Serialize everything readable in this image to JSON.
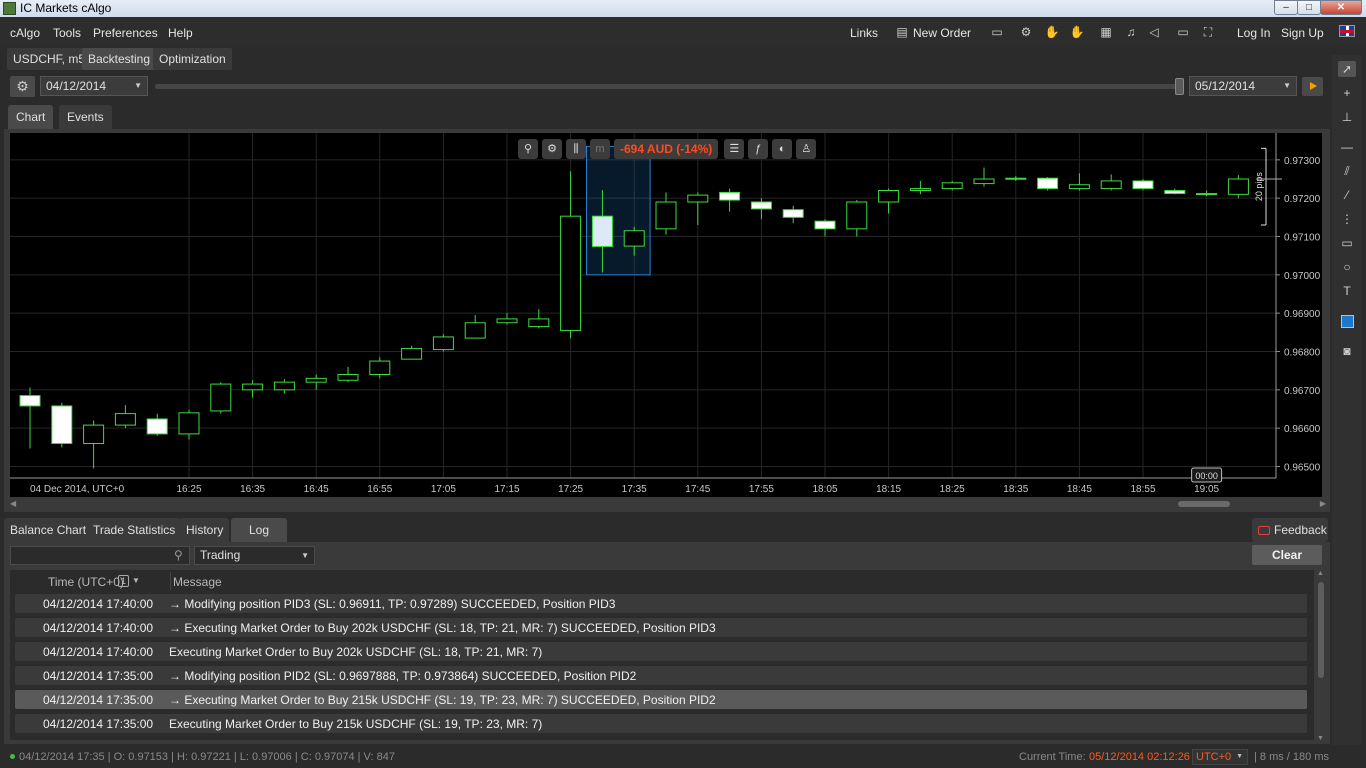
{
  "window": {
    "title": "IC Markets cAlgo",
    "min": "–",
    "max": "□",
    "close": "✕"
  },
  "menu": {
    "items": [
      "cAlgo",
      "Tools",
      "Preferences",
      "Help"
    ]
  },
  "topright": {
    "links": "Links",
    "new_order": "New Order",
    "login": "Log In",
    "signup": "Sign Up"
  },
  "tabs": [
    "USDCHF, m5",
    "Backtesting",
    "Optimization"
  ],
  "backtest": {
    "start_date": "04/12/2014",
    "end_date": "05/12/2014"
  },
  "chart_tabs": [
    "Chart",
    "Events"
  ],
  "chart_toolbar": {
    "pnl": "-694 AUD (-14%)"
  },
  "chart_data": {
    "type": "candlestick",
    "symbol": "USDCHF",
    "timeframe": "m5",
    "date_label": "04 Dec 2014, UTC+0",
    "x_ticks": [
      "16:25",
      "16:35",
      "16:45",
      "16:55",
      "17:05",
      "17:15",
      "17:25",
      "17:35",
      "17:45",
      "17:55",
      "18:05",
      "18:15",
      "18:25",
      "18:35",
      "18:45",
      "18:55",
      "19:05"
    ],
    "y_ticks": [
      "0.97300",
      "0.97200",
      "0.97100",
      "0.97000",
      "0.96900",
      "0.96800",
      "0.96700",
      "0.96600",
      "0.96500"
    ],
    "ylim": [
      0.9647,
      0.9737
    ],
    "crosshair_time": "00:00",
    "pips_label": "20 pips",
    "candles": [
      {
        "o": 0.96685,
        "h": 0.96706,
        "l": 0.96547,
        "c": 0.96658
      },
      {
        "o": 0.96658,
        "h": 0.96666,
        "l": 0.9655,
        "c": 0.9656
      },
      {
        "o": 0.9656,
        "h": 0.9662,
        "l": 0.96495,
        "c": 0.96608
      },
      {
        "o": 0.96608,
        "h": 0.9666,
        "l": 0.966,
        "c": 0.96638
      },
      {
        "o": 0.96624,
        "h": 0.96638,
        "l": 0.9658,
        "c": 0.96585
      },
      {
        "o": 0.96585,
        "h": 0.96648,
        "l": 0.9657,
        "c": 0.9664
      },
      {
        "o": 0.96645,
        "h": 0.9672,
        "l": 0.96638,
        "c": 0.96715
      },
      {
        "o": 0.967,
        "h": 0.96725,
        "l": 0.9668,
        "c": 0.96715
      },
      {
        "o": 0.967,
        "h": 0.96728,
        "l": 0.9669,
        "c": 0.9672
      },
      {
        "o": 0.9672,
        "h": 0.9674,
        "l": 0.967,
        "c": 0.9673
      },
      {
        "o": 0.96725,
        "h": 0.9676,
        "l": 0.9672,
        "c": 0.9674
      },
      {
        "o": 0.9674,
        "h": 0.96785,
        "l": 0.9673,
        "c": 0.96775
      },
      {
        "o": 0.9678,
        "h": 0.96815,
        "l": 0.9678,
        "c": 0.96808
      },
      {
        "o": 0.96805,
        "h": 0.96845,
        "l": 0.968,
        "c": 0.96838
      },
      {
        "o": 0.96835,
        "h": 0.96895,
        "l": 0.96835,
        "c": 0.96875
      },
      {
        "o": 0.96875,
        "h": 0.969,
        "l": 0.9687,
        "c": 0.96885
      },
      {
        "o": 0.96865,
        "h": 0.9691,
        "l": 0.9686,
        "c": 0.96885
      },
      {
        "o": 0.96855,
        "h": 0.9727,
        "l": 0.96835,
        "c": 0.97153
      },
      {
        "o": 0.97153,
        "h": 0.97221,
        "l": 0.97006,
        "c": 0.97074
      },
      {
        "o": 0.97075,
        "h": 0.97125,
        "l": 0.9705,
        "c": 0.97115
      },
      {
        "o": 0.9712,
        "h": 0.97215,
        "l": 0.97105,
        "c": 0.9719
      },
      {
        "o": 0.9719,
        "h": 0.97215,
        "l": 0.9713,
        "c": 0.97208
      },
      {
        "o": 0.97215,
        "h": 0.97225,
        "l": 0.97165,
        "c": 0.97195
      },
      {
        "o": 0.9719,
        "h": 0.972,
        "l": 0.97145,
        "c": 0.97172
      },
      {
        "o": 0.9717,
        "h": 0.9718,
        "l": 0.97135,
        "c": 0.9715
      },
      {
        "o": 0.9714,
        "h": 0.97145,
        "l": 0.971,
        "c": 0.9712
      },
      {
        "o": 0.9712,
        "h": 0.97195,
        "l": 0.971,
        "c": 0.9719
      },
      {
        "o": 0.9719,
        "h": 0.97225,
        "l": 0.9716,
        "c": 0.9722
      },
      {
        "o": 0.9722,
        "h": 0.97245,
        "l": 0.9721,
        "c": 0.97225
      },
      {
        "o": 0.97225,
        "h": 0.97245,
        "l": 0.9722,
        "c": 0.9724
      },
      {
        "o": 0.97238,
        "h": 0.9728,
        "l": 0.9723,
        "c": 0.9725
      },
      {
        "o": 0.9725,
        "h": 0.97258,
        "l": 0.97245,
        "c": 0.97252
      },
      {
        "o": 0.97252,
        "h": 0.97255,
        "l": 0.9722,
        "c": 0.97225
      },
      {
        "o": 0.97225,
        "h": 0.97265,
        "l": 0.9722,
        "c": 0.97235
      },
      {
        "o": 0.97225,
        "h": 0.97262,
        "l": 0.9722,
        "c": 0.97245
      },
      {
        "o": 0.97245,
        "h": 0.9725,
        "l": 0.9722,
        "c": 0.97225
      },
      {
        "o": 0.9722,
        "h": 0.97225,
        "l": 0.9721,
        "c": 0.97212
      },
      {
        "o": 0.97212,
        "h": 0.9722,
        "l": 0.97205,
        "c": 0.97212
      },
      {
        "o": 0.9721,
        "h": 0.9726,
        "l": 0.972,
        "c": 0.9725
      }
    ],
    "highlight_range": {
      "start_index": 18,
      "end_index": 19
    }
  },
  "bottom_tabs": [
    "Balance Chart",
    "Trade Statistics",
    "History",
    "Log"
  ],
  "feedback": "Feedback",
  "log": {
    "search_placeholder": "",
    "filter": "Trading",
    "clear": "Clear",
    "col_time": "Time (UTC+0)",
    "col_sort": "1",
    "col_msg": "Message",
    "rows": [
      {
        "time": "04/12/2014 17:40:00",
        "msg": "→ Modifying position PID3 (SL: 0.96911, TP: 0.97289) SUCCEEDED, Position PID3"
      },
      {
        "time": "04/12/2014 17:40:00",
        "msg": "→ Executing Market Order to Buy 202k USDCHF (SL: 18, TP: 21, MR: 7) SUCCEEDED, Position PID3"
      },
      {
        "time": "04/12/2014 17:40:00",
        "msg": "Executing Market Order to Buy 202k USDCHF (SL: 18, TP: 21, MR: 7)"
      },
      {
        "time": "04/12/2014 17:35:00",
        "msg": "→ Modifying position PID2 (SL: 0.9697888, TP: 0.973864) SUCCEEDED, Position PID2"
      },
      {
        "time": "04/12/2014 17:35:00",
        "msg": "→ Executing Market Order to Buy 215k USDCHF (SL: 19, TP: 23, MR: 7) SUCCEEDED, Position PID2"
      },
      {
        "time": "04/12/2014 17:35:00",
        "msg": "Executing Market Order to Buy 215k USDCHF (SL: 19, TP: 23, MR: 7)"
      }
    ],
    "selected_row": 4
  },
  "status": {
    "ohlc": "04/12/2014 17:35 | O: 0.97153 | H: 0.97221 | L: 0.97006 | C: 0.97074 | V: 847",
    "current_time_label": "Current Time:",
    "current_time": "05/12/2014 02:12:26",
    "timezone": "UTC+0",
    "latency": "| 8 ms / 180 ms"
  },
  "colors": {
    "accent": "#ff5a1f",
    "candle_border": "#3ddc3d",
    "chart_bg": "#000000",
    "highlight": "#1e78c8"
  }
}
